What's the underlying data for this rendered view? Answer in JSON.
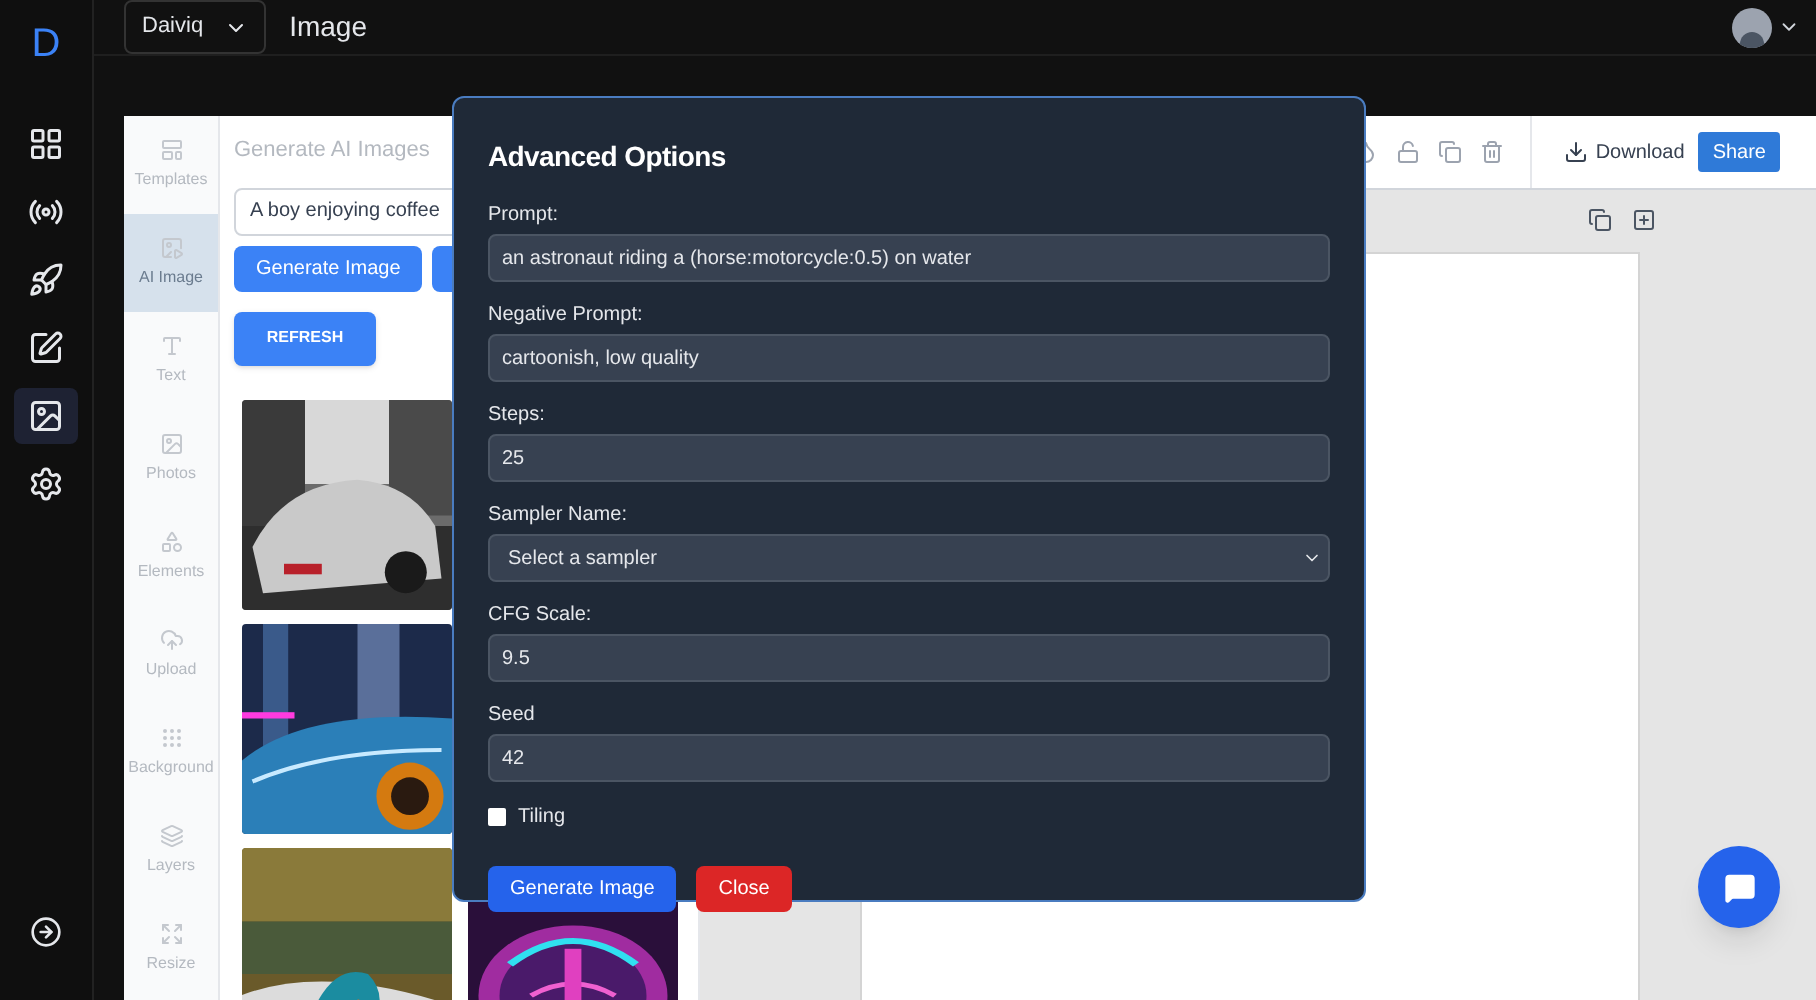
{
  "app_sidebar": {
    "logo": "D",
    "items": [
      {
        "selected": false
      },
      {
        "selected": false
      },
      {
        "selected": false
      },
      {
        "selected": false
      },
      {
        "selected": true
      },
      {
        "selected": false
      }
    ]
  },
  "top_bar": {
    "workspace": "Daiviq",
    "title": "Image"
  },
  "editor_tabs": [
    {
      "label": "Templates",
      "selected": false
    },
    {
      "label": "AI Image",
      "selected": true
    },
    {
      "label": "Text",
      "selected": false
    },
    {
      "label": "Photos",
      "selected": false
    },
    {
      "label": "Elements",
      "selected": false
    },
    {
      "label": "Upload",
      "selected": false
    },
    {
      "label": "Background",
      "selected": false
    },
    {
      "label": "Layers",
      "selected": false
    },
    {
      "label": "Resize",
      "selected": false
    }
  ],
  "panel": {
    "title": "Generate AI Images",
    "prompt": "A boy enjoying coffee",
    "generate_button": "Generate Image",
    "refresh_button": "REFRESH"
  },
  "toolbar": {
    "download": "Download",
    "share": "Share"
  },
  "modal": {
    "title": "Advanced Options",
    "fields": [
      {
        "kind": "text",
        "label": "Prompt:",
        "value": "an astronaut riding a (horse:motorcycle:0.5) on water"
      },
      {
        "kind": "text",
        "label": "Negative Prompt:",
        "value": "cartoonish, low quality"
      },
      {
        "kind": "text",
        "label": "Steps:",
        "value": "25"
      },
      {
        "kind": "select",
        "label": "Sampler Name:",
        "placeholder": "Select a sampler"
      },
      {
        "kind": "text",
        "label": "CFG Scale:",
        "value": "9.5"
      },
      {
        "kind": "text",
        "label": "Seed",
        "value": "42"
      }
    ],
    "tiling": {
      "label": "Tiling",
      "checked": false
    },
    "generate_button": "Generate Image",
    "close_button": "Close"
  }
}
